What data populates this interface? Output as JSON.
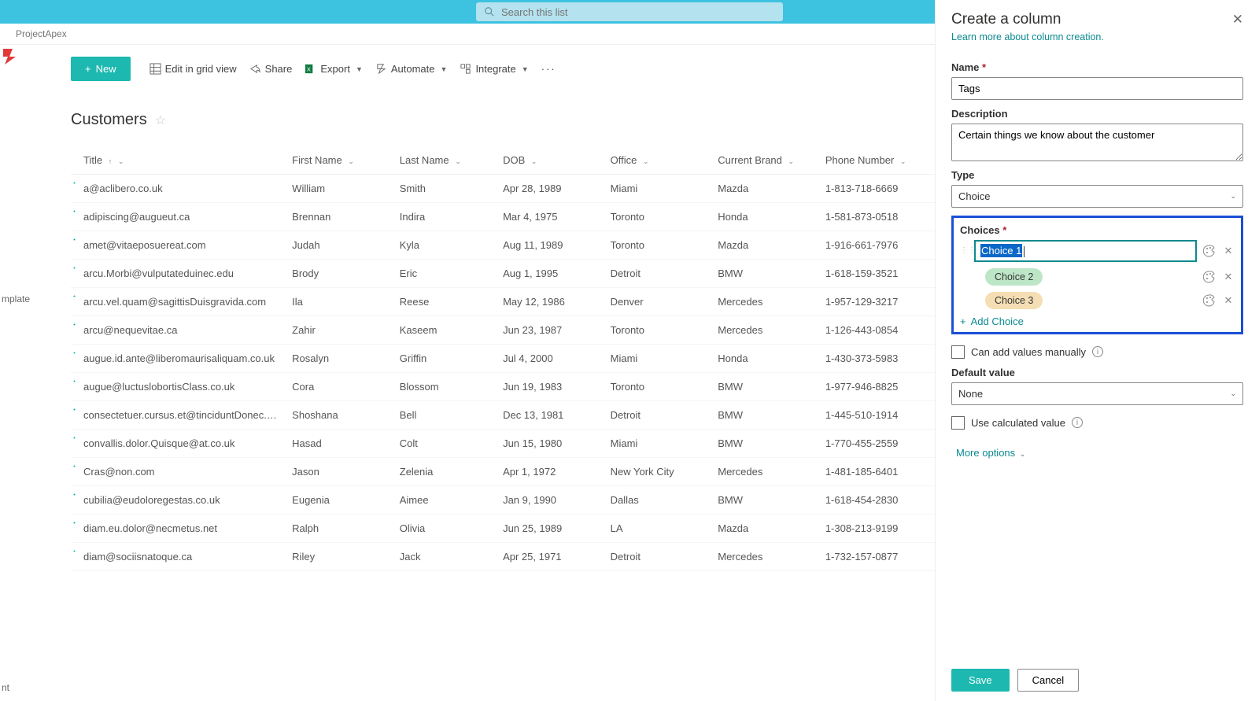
{
  "search": {
    "placeholder": "Search this list"
  },
  "breadcrumb": "ProjectApex",
  "leftnav": {
    "mplate": "mplate",
    "nt": "nt"
  },
  "toolbar": {
    "new": "New",
    "editGrid": "Edit in grid view",
    "share": "Share",
    "export": "Export",
    "automate": "Automate",
    "integrate": "Integrate"
  },
  "list": {
    "title": "Customers",
    "columns": [
      "Title",
      "First Name",
      "Last Name",
      "DOB",
      "Office",
      "Current Brand",
      "Phone Number"
    ],
    "rows": [
      {
        "title": "a@aclibero.co.uk",
        "first": "William",
        "last": "Smith",
        "dob": "Apr 28, 1989",
        "office": "Miami",
        "brand": "Mazda",
        "phone": "1-813-718-6669"
      },
      {
        "title": "adipiscing@augueut.ca",
        "first": "Brennan",
        "last": "Indira",
        "dob": "Mar 4, 1975",
        "office": "Toronto",
        "brand": "Honda",
        "phone": "1-581-873-0518"
      },
      {
        "title": "amet@vitaeposuereat.com",
        "first": "Judah",
        "last": "Kyla",
        "dob": "Aug 11, 1989",
        "office": "Toronto",
        "brand": "Mazda",
        "phone": "1-916-661-7976"
      },
      {
        "title": "arcu.Morbi@vulputateduinec.edu",
        "first": "Brody",
        "last": "Eric",
        "dob": "Aug 1, 1995",
        "office": "Detroit",
        "brand": "BMW",
        "phone": "1-618-159-3521"
      },
      {
        "title": "arcu.vel.quam@sagittisDuisgravida.com",
        "first": "Ila",
        "last": "Reese",
        "dob": "May 12, 1986",
        "office": "Denver",
        "brand": "Mercedes",
        "phone": "1-957-129-3217"
      },
      {
        "title": "arcu@nequevitae.ca",
        "first": "Zahir",
        "last": "Kaseem",
        "dob": "Jun 23, 1987",
        "office": "Toronto",
        "brand": "Mercedes",
        "phone": "1-126-443-0854"
      },
      {
        "title": "augue.id.ante@liberomaurisaliquam.co.uk",
        "first": "Rosalyn",
        "last": "Griffin",
        "dob": "Jul 4, 2000",
        "office": "Miami",
        "brand": "Honda",
        "phone": "1-430-373-5983"
      },
      {
        "title": "augue@luctuslobortisClass.co.uk",
        "first": "Cora",
        "last": "Blossom",
        "dob": "Jun 19, 1983",
        "office": "Toronto",
        "brand": "BMW",
        "phone": "1-977-946-8825"
      },
      {
        "title": "consectetuer.cursus.et@tinciduntDonec.co.uk",
        "first": "Shoshana",
        "last": "Bell",
        "dob": "Dec 13, 1981",
        "office": "Detroit",
        "brand": "BMW",
        "phone": "1-445-510-1914"
      },
      {
        "title": "convallis.dolor.Quisque@at.co.uk",
        "first": "Hasad",
        "last": "Colt",
        "dob": "Jun 15, 1980",
        "office": "Miami",
        "brand": "BMW",
        "phone": "1-770-455-2559"
      },
      {
        "title": "Cras@non.com",
        "first": "Jason",
        "last": "Zelenia",
        "dob": "Apr 1, 1972",
        "office": "New York City",
        "brand": "Mercedes",
        "phone": "1-481-185-6401"
      },
      {
        "title": "cubilia@eudoloregestas.co.uk",
        "first": "Eugenia",
        "last": "Aimee",
        "dob": "Jan 9, 1990",
        "office": "Dallas",
        "brand": "BMW",
        "phone": "1-618-454-2830"
      },
      {
        "title": "diam.eu.dolor@necmetus.net",
        "first": "Ralph",
        "last": "Olivia",
        "dob": "Jun 25, 1989",
        "office": "LA",
        "brand": "Mazda",
        "phone": "1-308-213-9199"
      },
      {
        "title": "diam@sociisnatoque.ca",
        "first": "Riley",
        "last": "Jack",
        "dob": "Apr 25, 1971",
        "office": "Detroit",
        "brand": "Mercedes",
        "phone": "1-732-157-0877"
      }
    ]
  },
  "panel": {
    "title": "Create a column",
    "learn": "Learn more about column creation.",
    "nameLabel": "Name",
    "nameValue": "Tags",
    "descLabel": "Description",
    "descValue": "Certain things we know about the customer",
    "typeLabel": "Type",
    "typeValue": "Choice",
    "choicesLabel": "Choices",
    "choice1": "Choice 1",
    "choice2": "Choice 2",
    "choice3": "Choice 3",
    "addChoice": "Add Choice",
    "canAdd": "Can add values manually",
    "defaultLabel": "Default value",
    "defaultValue": "None",
    "useCalc": "Use calculated value",
    "moreOpt": "More options",
    "save": "Save",
    "cancel": "Cancel"
  }
}
